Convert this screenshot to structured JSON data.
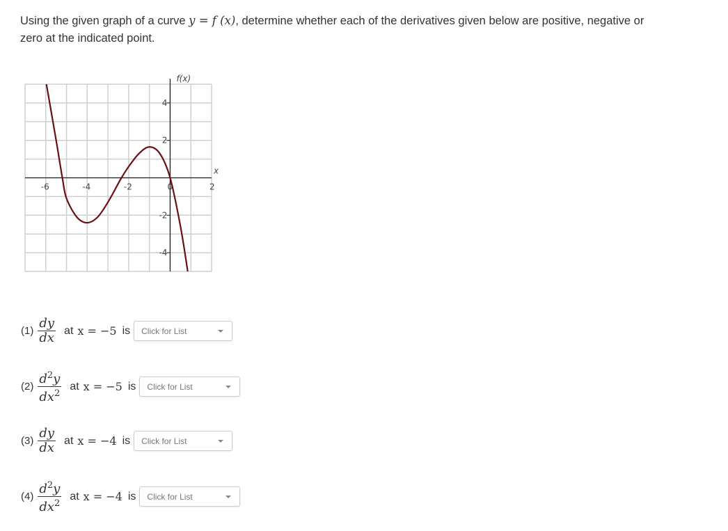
{
  "instructions": {
    "part1": "Using the given graph of a curve ",
    "math": "y = f (x)",
    "part2": ", determine whether each of the derivatives given below are positive, negative or zero at the indicated point."
  },
  "chart_data": {
    "type": "line",
    "title": "",
    "xlabel": "x",
    "ylabel": "f(x)",
    "xlim": [
      -7,
      2
    ],
    "ylim": [
      -5,
      5
    ],
    "grid": true,
    "x_ticks": [
      {
        "value": -6,
        "label": "-6"
      },
      {
        "value": -4,
        "label": "-4"
      },
      {
        "value": -2,
        "label": "-2"
      },
      {
        "value": 0,
        "label": "0"
      },
      {
        "value": 2,
        "label": "2"
      }
    ],
    "y_ticks": [
      {
        "value": 4,
        "label": "4"
      },
      {
        "value": 2,
        "label": "2"
      },
      {
        "value": -2,
        "label": "-2"
      },
      {
        "value": -4,
        "label": "-4"
      }
    ],
    "series": [
      {
        "name": "f(x)",
        "color": "#6b0f17",
        "points": [
          [
            -6.0,
            5.2
          ],
          [
            -5.5,
            2.0
          ],
          [
            -5.2,
            0.0
          ],
          [
            -5.0,
            -1.1
          ],
          [
            -4.5,
            -2.1
          ],
          [
            -4.0,
            -2.4
          ],
          [
            -3.5,
            -2.1
          ],
          [
            -3.0,
            -1.3
          ],
          [
            -2.5,
            -0.3
          ],
          [
            -2.35,
            0.0
          ],
          [
            -2.0,
            0.6
          ],
          [
            -1.5,
            1.3
          ],
          [
            -1.0,
            1.65
          ],
          [
            -0.5,
            1.3
          ],
          [
            0.0,
            0.0
          ],
          [
            0.5,
            -2.6
          ],
          [
            0.85,
            -5.0
          ]
        ],
        "features": {
          "roots": [
            -5.2,
            -2.35,
            0
          ],
          "local_min": [
            -4,
            -2.4
          ],
          "local_max": [
            -0.9,
            1.65
          ]
        }
      }
    ]
  },
  "questions": [
    {
      "number": "(1)",
      "numerator": "dy",
      "order": "",
      "denominator": "dx",
      "at": "at",
      "expr": "x = −5",
      "is": "is",
      "placeholder": "Click for List"
    },
    {
      "number": "(2)",
      "numerator": "d",
      "order": "2",
      "numerator_var": "y",
      "denominator": "dx",
      "at": "at",
      "expr": "x = −5",
      "is": "is",
      "placeholder": "Click for List"
    },
    {
      "number": "(3)",
      "numerator": "dy",
      "order": "",
      "denominator": "dx",
      "at": "at",
      "expr": "x = −4",
      "is": "is",
      "placeholder": "Click for List"
    },
    {
      "number": "(4)",
      "numerator": "d",
      "order": "2",
      "numerator_var": "y",
      "denominator": "dx",
      "at": "at",
      "expr": "x = −4",
      "is": "is",
      "placeholder": "Click for List"
    }
  ]
}
